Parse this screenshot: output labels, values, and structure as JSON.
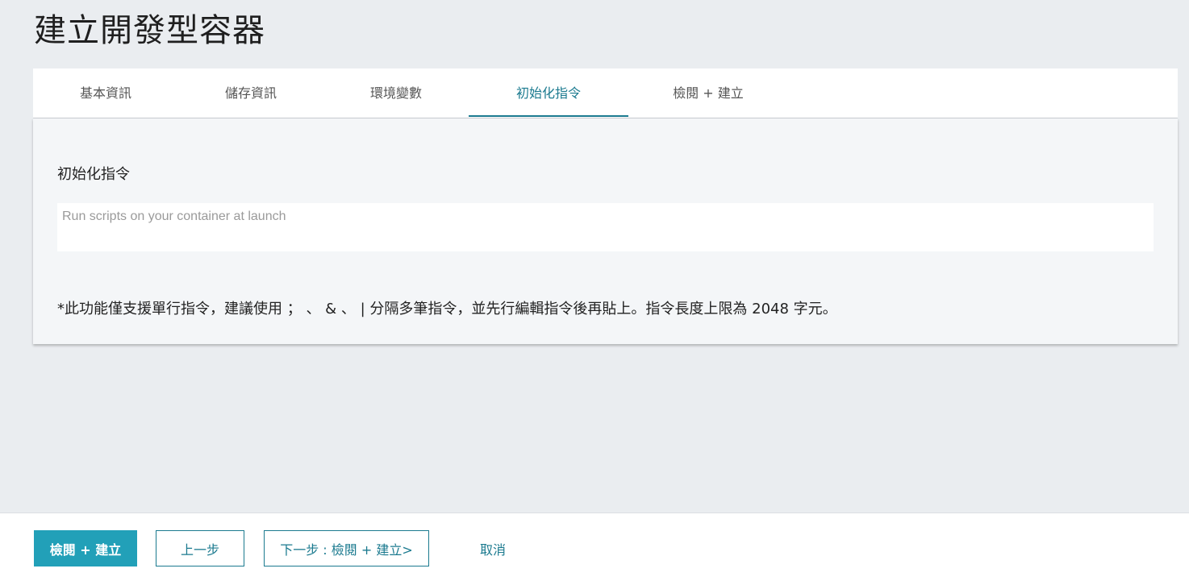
{
  "page": {
    "title": "建立開發型容器"
  },
  "tabs": [
    {
      "label": "基本資訊",
      "active": false
    },
    {
      "label": "儲存資訊",
      "active": false
    },
    {
      "label": "環境變數",
      "active": false
    },
    {
      "label": "初始化指令",
      "active": true
    },
    {
      "label": "檢閱 + 建立",
      "active": false
    }
  ],
  "form": {
    "label": "初始化指令",
    "input_value": "",
    "input_placeholder": "Run scripts on your container at launch",
    "note": "*此功能僅支援單行指令，建議使用 ； 、 & 、 | 分隔多筆指令，並先行編輯指令後再貼上。指令長度上限為 2048 字元。"
  },
  "footer": {
    "review_create_label": "檢閱 + 建立",
    "prev_label": "上一步",
    "next_label": "下一步 : 檢閱 + 建立>",
    "cancel_label": "取消"
  },
  "colors": {
    "accent": "#1b7a8f",
    "primary_button": "#22a0b8",
    "background": "#eaedf0",
    "panel": "#f4f6f8"
  }
}
